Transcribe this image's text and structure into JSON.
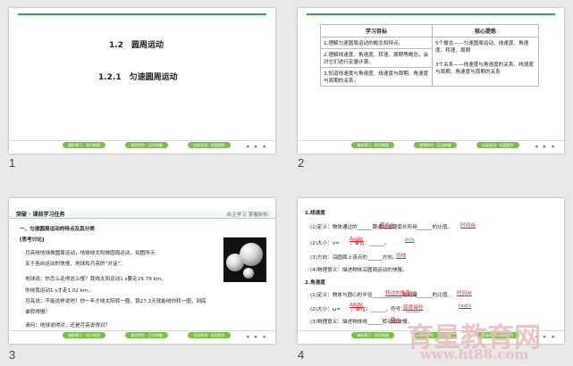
{
  "slides": [
    {
      "number": "1",
      "heading1": "1.2　圆周运动",
      "heading2": "1.2.1　匀速圆周运动"
    },
    {
      "number": "2",
      "table_head": [
        "学习目标",
        "核心提炼"
      ],
      "goals": [
        "1.理解匀速圆周运动的概念和特点。",
        "2.理解线速度、角速度、转速、周期等概念，会对它们进行定量计算。",
        "3.知道线速度与角速度、线速度与周期、角速度与周期的关系。"
      ],
      "core": [
        "5个概念——匀速圆周运动、线速度、角速度、转速、周期",
        "3个关系——线速度与角速度的关系、线速度与周期、角速度与周期的关系"
      ]
    },
    {
      "number": "3",
      "bar_title": "突破 · 课前学习任务",
      "bar_right": "自主学习  掌握新知",
      "section": "一、匀速圆周运动的特点及其分类",
      "sub": "[思考讨论]",
      "lines": [
        "月亮绕地球做圆周运动，地球绕太阳做圆周运动，如图所示",
        "关于各自运动的快慢，地球和月亮的“对话”：",
        "地球说：你怎么走得这么慢？我绕太阳运动1 s要走29.79 km，",
        "你绕我运动1 s才走1.02 km。",
        "月亮说：不能这样说吧！你一年才绕太阳转一圈，我27.3天就能绕你转一圈，到底",
        "谁转得慢？",
        "请问：地球说得对，还是月亮说得对？"
      ]
    },
    {
      "number": "4",
      "lines": [
        "1.线速度",
        "(1)定义：物体通过的______跟通过这段弧长所用______的比值。",
        "(2)大小：v=　　，单位：______。",
        "(3)方向：沿圆周上该点的______方向。",
        "(4)物理意义：描述物体沿圆周运动的快慢。",
        "2.角速度",
        "(1)定义：物体与圆心的半径____________与所用______的比值。",
        "(2)大小：ω=　　，单位：______，符号：______。",
        "(3)物理意义：描述物体绕______转动的快慢。"
      ],
      "answers": [
        "弧长Δs",
        "时间Δt",
        "m/s",
        "切线",
        "转过的角度Δθ",
        "时间Δt",
        "弧度每秒",
        "rad/s",
        "圆心"
      ],
      "fractions": [
        "Δs/Δt",
        "Δθ/Δt"
      ]
    }
  ],
  "pill_labels": [
    "课前预习 · 知识梳理",
    "课堂探究 · 互动突破",
    "达标检测 · 巩固提升",
    "课后作业 · 限时训练"
  ],
  "nav_arrows": "◂ ▸ ▸",
  "watermark": {
    "cn": "育星教育网",
    "url": "www.ht88.com",
    "color": "#e8bcbc"
  }
}
